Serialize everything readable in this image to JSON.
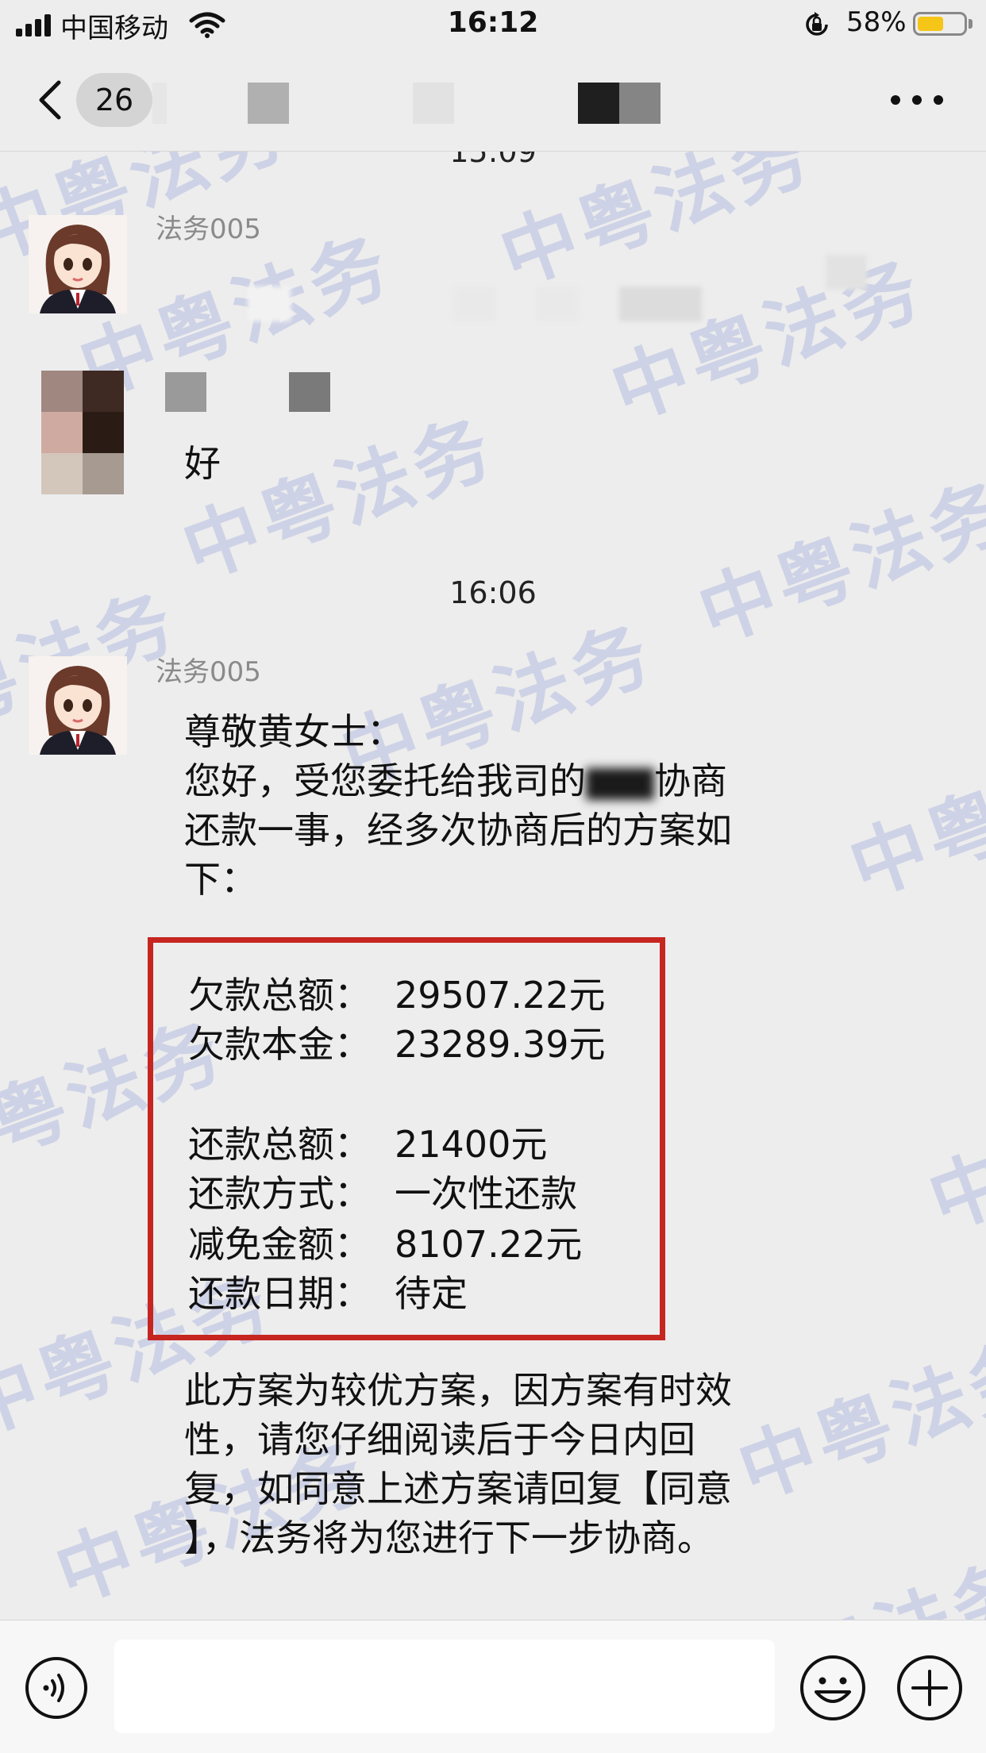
{
  "status_bar": {
    "carrier": "中国移动",
    "time": "16:12",
    "battery_percent": "58%",
    "battery_level": 0.58,
    "battery_color": "#f5c518"
  },
  "nav": {
    "unread_count": "26",
    "back_icon": "chevron-left-icon",
    "more_icon": "ellipsis-icon"
  },
  "watermark_text": "中粤法务",
  "chat": {
    "timestamps": [
      "15:09",
      "16:06"
    ],
    "messages": [
      {
        "sender": "法务005",
        "type": "redacted"
      },
      {
        "sender": "",
        "text": "好"
      },
      {
        "sender": "法务005",
        "greeting": "尊敬黄女士：",
        "intro_line1_before": "您好，受您委托给我司的",
        "intro_line1_after": "协商",
        "intro_line2": "还款一事，经多次协商后的方案如",
        "intro_line3": "下：",
        "plan": {
          "border_color": "#c62520",
          "rows": [
            {
              "label": "欠款总额：",
              "value": "29507.22元"
            },
            {
              "label": "欠款本金：",
              "value": "23289.39元"
            },
            {
              "label": "还款总额：",
              "value": "21400元"
            },
            {
              "label": "还款方式：",
              "value": "一次性还款"
            },
            {
              "label": "减免金额：",
              "value": "8107.22元"
            },
            {
              "label": "还款日期：",
              "value": "待定"
            }
          ]
        },
        "closing_lines": [
          "此方案为较优方案，因方案有时效",
          "性，请您仔细阅读后于今日内回",
          "复，如同意上述方案请回复【同意",
          "】，法务将为您进行下一步协商。"
        ]
      }
    ]
  },
  "input_bar": {
    "voice_icon": "voice-icon",
    "emoji_icon": "emoji-icon",
    "plus_icon": "plus-icon",
    "input_value": ""
  }
}
